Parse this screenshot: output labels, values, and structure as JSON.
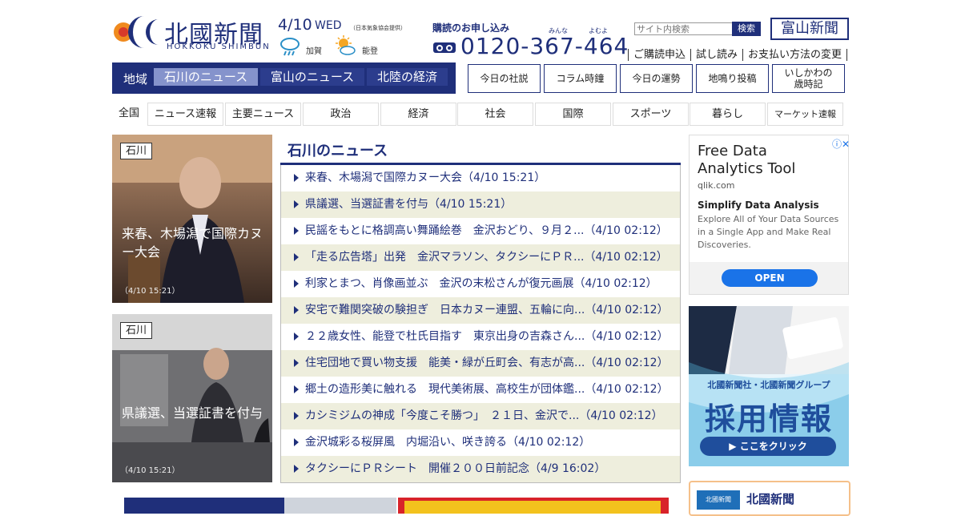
{
  "header": {
    "logo_title": "北國新聞",
    "logo_sub": "HOKKOKU SHIMBUN",
    "date": "4/10",
    "day": "WED",
    "weather_source": "（日本気象協会提供）",
    "weather": [
      {
        "area": "加賀",
        "icon": "rain-cloud-icon"
      },
      {
        "area": "能登",
        "icon": "sun-cloud-icon"
      }
    ],
    "subscribe_label": "購読のお申し込み",
    "ruby_minna": "みんな",
    "ruby_yoyomu": "よむよ",
    "phone": "0120-367-464",
    "search_placeholder": "サイト内検索",
    "search_button": "検索",
    "toyama_link": "富山新聞",
    "top_links": [
      "ご購読申込",
      "試し読み",
      "お支払い方法の変更"
    ]
  },
  "region_nav": {
    "label": "地域",
    "tabs": [
      "石川のニュース",
      "富山のニュース",
      "北陸の経済"
    ]
  },
  "quick_links": [
    "今日の社説",
    "コラム時鐘",
    "今日の運勢",
    "地鳴り投稿",
    "いしかわの\n歳時記"
  ],
  "categories": [
    "全国",
    "ニュース速報",
    "主要ニュース",
    "政治",
    "経済",
    "社会",
    "国際",
    "スポーツ",
    "暮らし",
    "マーケット速報"
  ],
  "feature_cards": [
    {
      "tag": "石川",
      "title": "来春、木場潟で国際カヌー大会",
      "time": "（4/10 15:21）"
    },
    {
      "tag": "石川",
      "title": "県議選、当選証書を付与",
      "time": "（4/10 15:21）"
    }
  ],
  "news": {
    "heading": "石川のニュース",
    "items": [
      "来春、木場潟で国際カヌー大会（4/10 15:21）",
      "県議選、当選証書を付与（4/10 15:21）",
      "民謡をもとに格調高い舞踊絵巻　金沢おどり、９月２...（4/10 02:12）",
      "「走る広告塔」出発　金沢マラソン、タクシーにＰＲ...（4/10 02:12）",
      "利家とまつ、肖像画並ぶ　金沢の末松さんが復元画展（4/10 02:12）",
      "安宅で難関突破の験担ぎ　日本カヌー連盟、五輪に向...（4/10 02:12）",
      "２２歳女性、能登で杜氏目指す　東京出身の吉森さん...（4/10 02:12）",
      "住宅団地で買い物支援　能美・緑が丘町会、有志が高...（4/10 02:12）",
      "郷土の造形美に触れる　現代美術展、高校生が団体鑑...（4/10 02:12）",
      "カシミジムの神成「今度こそ勝つ」　２１日、金沢で...（4/10 02:12）",
      "金沢城彩る桜屏風　内堀沿い、咲き誇る（4/10 02:12）",
      "タクシーにＰＲシート　開催２００日前記念（4/9 16:02）"
    ]
  },
  "ads": {
    "ad1": {
      "title": "Free Data Analytics Tool",
      "url": "qlik.com",
      "subtitle": "Simplify Data Analysis",
      "desc": "Explore All of Your Data Sources in a Single App and Make Real Discoveries.",
      "button": "OPEN"
    },
    "ad2": {
      "line1": "北國新聞社・北國新聞グループ",
      "headline": "採用情報",
      "button": "▶ ここをクリック"
    },
    "ad3": {
      "title": "北國新聞",
      "badge": "北國新聞"
    }
  },
  "colors": {
    "brand": "#1f2f7a",
    "active_tab": "#8593cc",
    "alt_row": "#eeeedd",
    "ad_button": "#1a73e8"
  }
}
